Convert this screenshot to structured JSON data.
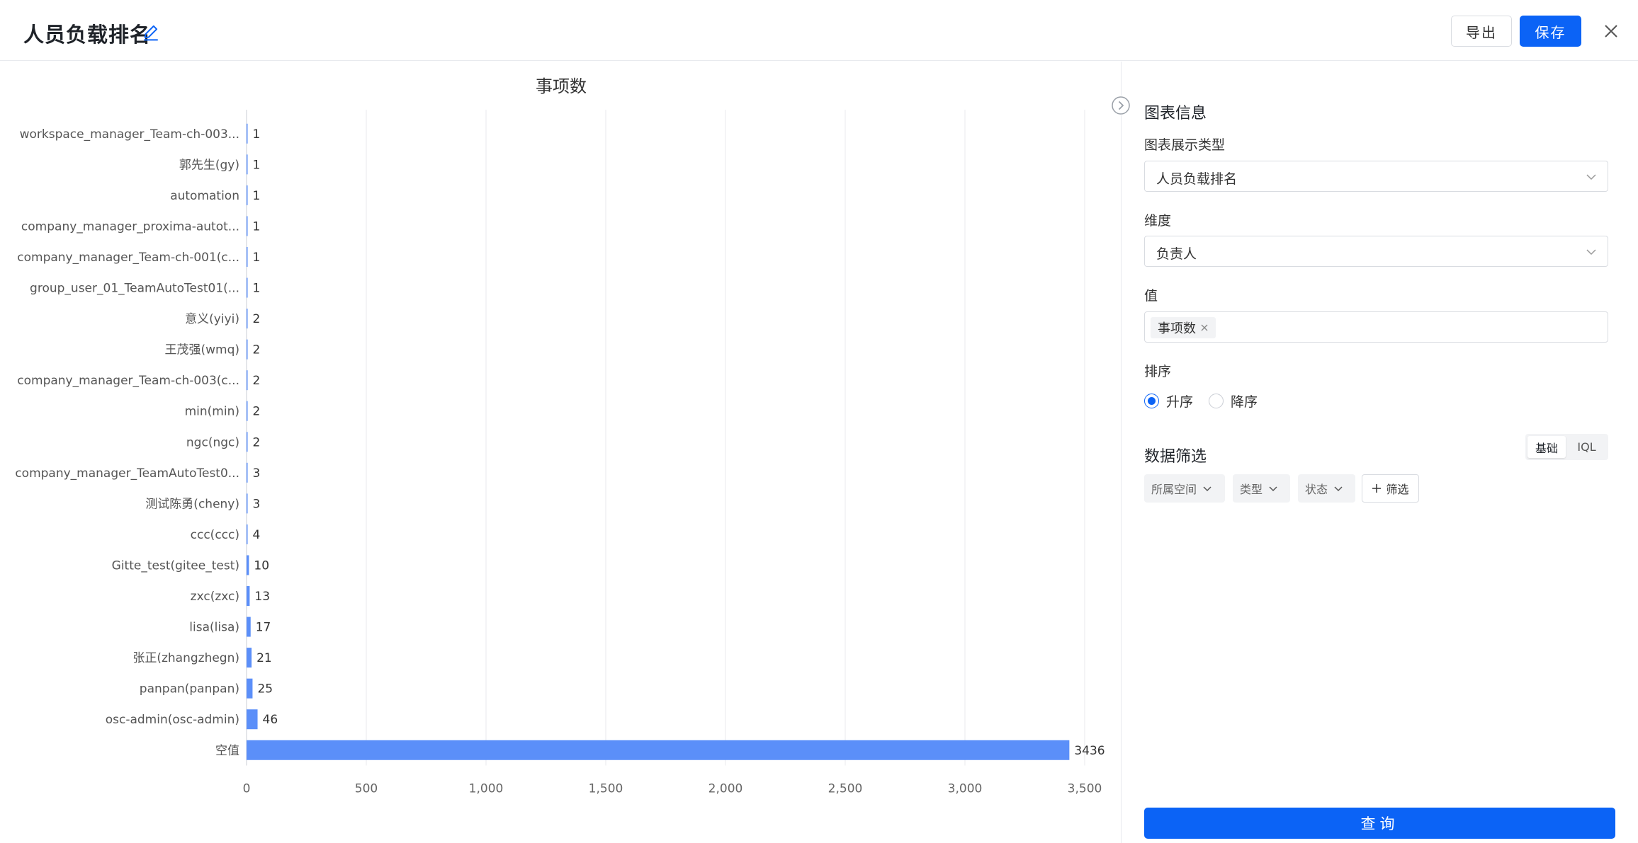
{
  "header": {
    "title": "人员负载排名",
    "export_label": "导出",
    "save_label": "保存"
  },
  "panel": {
    "title": "图表信息",
    "chart_type_label": "图表展示类型",
    "chart_type_value": "人员负载排名",
    "dimension_label": "维度",
    "dimension_value": "负责人",
    "value_label": "值",
    "value_tag": "事项数",
    "sort_label": "排序",
    "sort_asc": "升序",
    "sort_desc": "降序",
    "filter_title": "数据筛选",
    "mode_basic": "基础",
    "mode_iql": "IQL",
    "filters": [
      "所属空间",
      "类型",
      "状态"
    ],
    "add_filter": "筛选",
    "query_label": "查询"
  },
  "colors": {
    "accent": "#0b63f6",
    "bar": "#5b8ff9"
  },
  "chart_data": {
    "type": "bar",
    "orientation": "horizontal",
    "title": "事项数",
    "categories": [
      "workspace_manager_Team-ch-003...",
      "郭先生(gy)",
      "automation",
      "company_manager_proxima-autot...",
      "company_manager_Team-ch-001(c...",
      "group_user_01_TeamAutoTest01(...",
      "意义(yiyi)",
      "王茂强(wmq)",
      "company_manager_Team-ch-003(c...",
      "min(min)",
      "ngc(ngc)",
      "company_manager_TeamAutoTest0...",
      "测试陈勇(cheny)",
      "ccc(ccc)",
      "Gitte_test(gitee_test)",
      "zxc(zxc)",
      "lisa(lisa)",
      "张正(zhangzhegn)",
      "panpan(panpan)",
      "osc-admin(osc-admin)",
      "空值"
    ],
    "values": [
      1,
      1,
      1,
      1,
      1,
      1,
      2,
      2,
      2,
      2,
      2,
      3,
      3,
      4,
      10,
      13,
      17,
      21,
      25,
      46,
      3436
    ],
    "xlim": [
      0,
      3500
    ],
    "xticks": [
      0,
      500,
      1000,
      1500,
      2000,
      2500,
      3000,
      3500
    ],
    "xtick_labels": [
      "0",
      "500",
      "1,000",
      "1,500",
      "2,000",
      "2,500",
      "3,000",
      "3,500"
    ],
    "grid": true,
    "data_labels": true
  }
}
